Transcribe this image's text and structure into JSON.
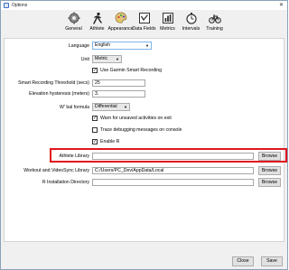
{
  "window": {
    "title": "Options",
    "close_glyph": "✕"
  },
  "toolbar": [
    {
      "label": "General",
      "icon": "gear-icon"
    },
    {
      "label": "Athlete",
      "icon": "runner-icon"
    },
    {
      "label": "Appearance",
      "icon": "palette-icon"
    },
    {
      "label": "Data Fields",
      "icon": "data-fields-icon"
    },
    {
      "label": "Metrics",
      "icon": "metrics-icon"
    },
    {
      "label": "Intervals",
      "icon": "stopwatch-icon"
    },
    {
      "label": "Training",
      "icon": "bicycle-icon"
    }
  ],
  "general": {
    "language": {
      "label": "Language",
      "value": "English"
    },
    "unit": {
      "label": "Unit",
      "value": "Metric"
    },
    "garmin_smart_recording": {
      "label": "Use Garmin Smart Recording",
      "checked": true
    },
    "smart_threshold": {
      "label": "Smart Recording Threshold (secs)",
      "value": "25"
    },
    "elevation_hysteresis": {
      "label": "Elevation hysteresis (meters)",
      "value": "3."
    },
    "wbal_formula": {
      "label": "W' bal formula",
      "value": "Differential"
    },
    "warn_unsaved": {
      "label": "Warn for unsaved activities on exit",
      "checked": true
    },
    "trace_debug": {
      "label": "Trace debugging messages on console",
      "checked": false
    },
    "enable_r": {
      "label": "Enable R",
      "checked": true
    },
    "athlete_library": {
      "label": "Athlete Library",
      "value": "",
      "button": "Browse"
    },
    "workout_library": {
      "label": "Workout and VideoSync Library",
      "value": "C:/Users/PC_Dev/AppData/Local",
      "button": "Browse"
    },
    "r_directory": {
      "label": "R Installation Directory",
      "value": "",
      "button": "Browse"
    }
  },
  "footer": {
    "close_label": "Close",
    "save_label": "Save"
  },
  "colors": {
    "highlight": "#e0161e",
    "accent": "#3c6cc4"
  }
}
